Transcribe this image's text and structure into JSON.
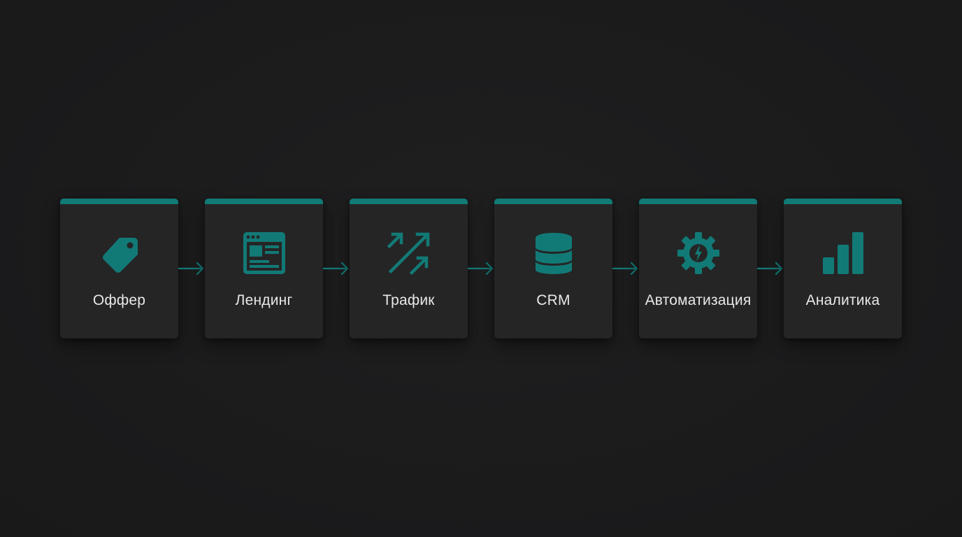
{
  "accent_color": "#127a76",
  "steps": [
    {
      "label": "Оффер",
      "icon": "price-tag-icon"
    },
    {
      "label": "Лендинг",
      "icon": "landing-page-icon"
    },
    {
      "label": "Трафик",
      "icon": "traffic-arrows-icon"
    },
    {
      "label": "CRM",
      "icon": "database-icon"
    },
    {
      "label": "Автоматизация",
      "icon": "gear-icon"
    },
    {
      "label": "Аналитика",
      "icon": "bar-chart-icon"
    }
  ]
}
